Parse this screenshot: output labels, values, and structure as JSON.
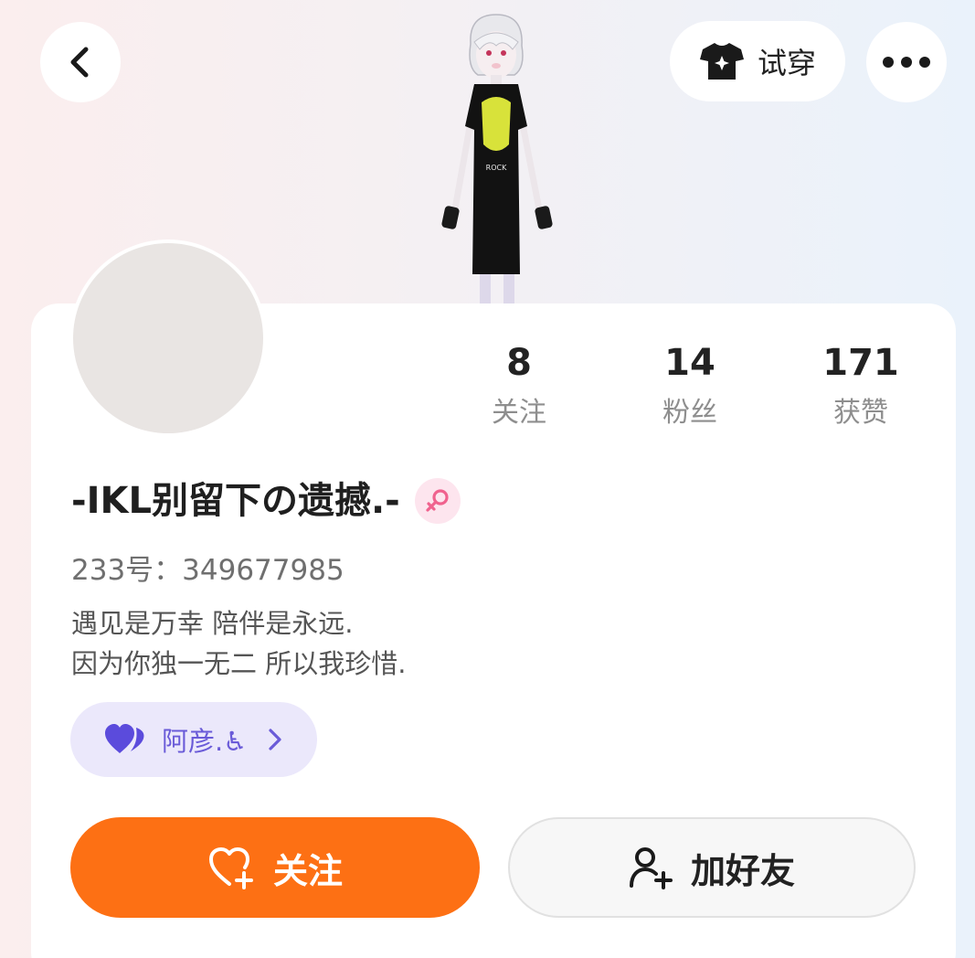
{
  "header": {
    "try_on_label": "试穿",
    "icons": {
      "back": "chevron-left-icon",
      "try_on": "tshirt-icon",
      "more": "more-dots-icon"
    }
  },
  "stats": [
    {
      "value": "8",
      "label": "关注"
    },
    {
      "value": "14",
      "label": "粉丝"
    },
    {
      "value": "171",
      "label": "获赞"
    }
  ],
  "profile": {
    "username": "-IKL别留下の遗撼.-",
    "gender": "female",
    "account_id": "233号：349677985",
    "bio_line_1": "遇见是万幸  陪伴是永远.",
    "bio_line_2": "因为你独一无二  所以我珍惜."
  },
  "cp": {
    "name": "阿彦.♿",
    "icon": "hearts-icon"
  },
  "actions": {
    "follow_label": "关注",
    "add_friend_label": "加好友"
  },
  "colors": {
    "accent_orange": "#fd7014",
    "cp_purple": "#6a5bd8",
    "gender_pink": "#f0628e"
  }
}
